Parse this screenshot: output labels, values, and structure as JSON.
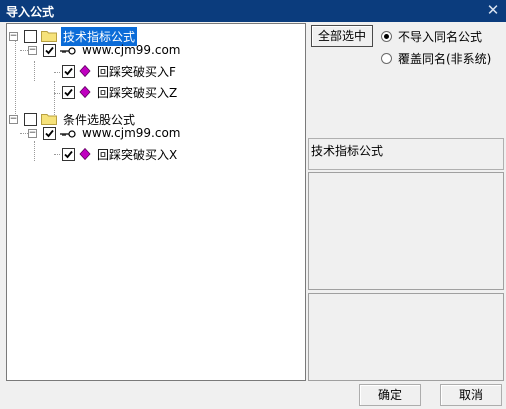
{
  "window": {
    "title": "导入公式",
    "close_glyph": "✕"
  },
  "tree": {
    "nodes": [
      {
        "label": "技术指标公式",
        "checked": false,
        "expander": "−",
        "icon": "folder-icon",
        "selected": true
      },
      {
        "label": "www.cjm99.com",
        "checked": true,
        "expander": "−",
        "icon": "key-icon",
        "selected": false
      },
      {
        "label": "回踩突破买入F",
        "checked": true,
        "icon": "formula-diamond-icon",
        "selected": false
      },
      {
        "label": "回踩突破买入Z",
        "checked": true,
        "icon": "formula-diamond-icon",
        "selected": false
      },
      {
        "label": "条件选股公式",
        "checked": false,
        "expander": "−",
        "icon": "folder-icon",
        "selected": false
      },
      {
        "label": "www.cjm99.com",
        "checked": true,
        "expander": "−",
        "icon": "key-icon",
        "selected": false
      },
      {
        "label": "回踩突破买入X",
        "checked": true,
        "icon": "formula-diamond-icon",
        "selected": false
      }
    ]
  },
  "options": {
    "select_all_label": "全部选中",
    "radio_skip_label": "不导入同名公式",
    "radio_overwrite_label": "覆盖同名(非系统)",
    "selected_radio": "skip"
  },
  "info": {
    "category_label": "技术指标公式"
  },
  "footer": {
    "ok_label": "确定",
    "cancel_label": "取消"
  },
  "colors": {
    "titlebar": "#0b3c7d",
    "selection": "#0b6cd8",
    "diamond": "#c000c0"
  }
}
